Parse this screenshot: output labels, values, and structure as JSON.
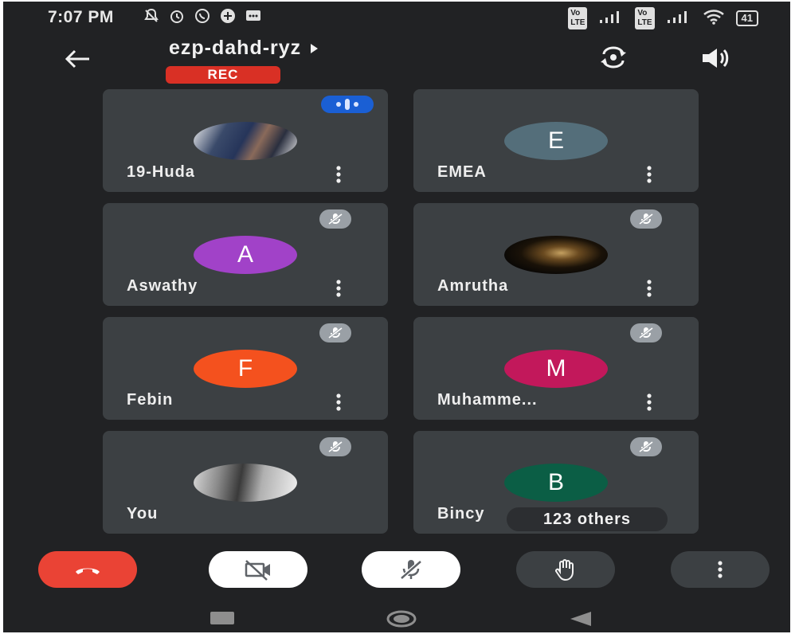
{
  "status_bar": {
    "time": "7:07 PM",
    "icons": [
      "notifications-off-icon",
      "alarm-icon",
      "whatsapp-icon",
      "sync-icon",
      "message-icon"
    ],
    "network": [
      "volte-icon",
      "signal-icon",
      "volte-icon",
      "4g-signal-icon",
      "wifi-icon"
    ],
    "battery": "41"
  },
  "header": {
    "back_icon": "arrow-left-icon",
    "meeting_code": "ezp-dahd-ryz",
    "rec_label": "REC",
    "switch_camera_icon": "switch-camera-icon",
    "audio_icon": "speaker-icon"
  },
  "participants": [
    {
      "name": "19-Huda",
      "avatar_type": "photo",
      "badge": "speaking"
    },
    {
      "name": "EMEA",
      "avatar_letter": "E",
      "avatar_color": "#546e7a",
      "badge": "none"
    },
    {
      "name": "Aswathy",
      "avatar_letter": "A",
      "avatar_color": "#a142c8",
      "badge": "muted"
    },
    {
      "name": "Amrutha",
      "avatar_type": "photo",
      "badge": "muted"
    },
    {
      "name": "Febin",
      "avatar_letter": "F",
      "avatar_color": "#f4511e",
      "badge": "muted"
    },
    {
      "name": "Muhamme...",
      "avatar_letter": "M",
      "avatar_color": "#c2185b",
      "badge": "muted"
    },
    {
      "name": "You",
      "avatar_type": "photo",
      "badge": "muted"
    },
    {
      "name": "Bincy",
      "avatar_letter": "B",
      "avatar_color": "#0b5e45",
      "badge": "muted"
    }
  ],
  "others_count_label": "123 others",
  "controls": {
    "end_call": "end-call-icon",
    "camera": "camera-off-icon",
    "microphone": "mic-off-icon",
    "raise_hand": "raise-hand-icon",
    "more": "more-vert-icon"
  },
  "colors": {
    "background": "#212224",
    "tile": "#3c4043",
    "end_call": "#ea4335",
    "rec": "#d93025",
    "speaking": "#1a5fd4"
  }
}
